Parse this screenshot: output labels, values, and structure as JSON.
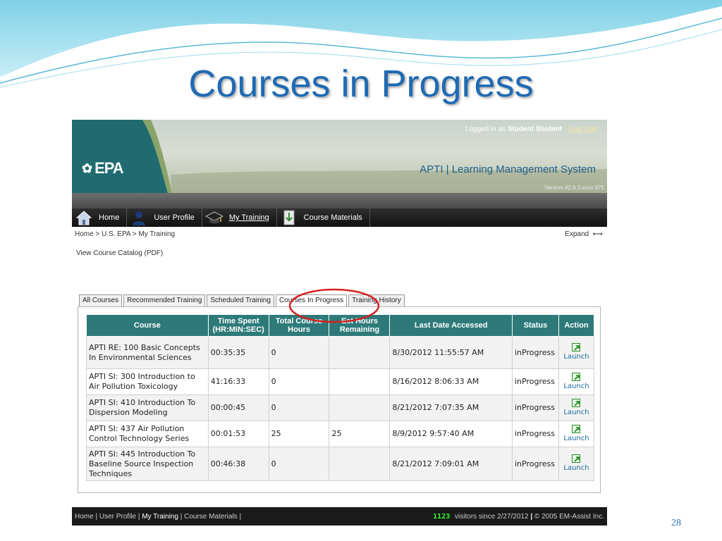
{
  "slide": {
    "title": "Courses in Progress",
    "number": "28"
  },
  "header": {
    "logo_text": "EPA",
    "logged_in_prefix": "Logged in as",
    "user_name": "Student Student",
    "logout_label": "[Log Out]",
    "system_title": "APTI | Learning Management System",
    "version": "Version #2.6.3.xxxx.975"
  },
  "nav": {
    "items": [
      {
        "label": "Home",
        "icon": "house-icon"
      },
      {
        "label": "User Profile",
        "icon": "person-icon"
      },
      {
        "label": "My Training",
        "icon": "graduation-cap-icon"
      },
      {
        "label": "Course Materials",
        "icon": "download-icon"
      }
    ],
    "active": "My Training"
  },
  "breadcrumb": "Home > U.S. EPA > My Training",
  "expand_label": "Expand",
  "catalog_link": "View Course Catalog (PDF)",
  "tabs": [
    {
      "label": "All Courses"
    },
    {
      "label": "Recommended Training"
    },
    {
      "label": "Scheduled Training"
    },
    {
      "label": "Courses In Progress"
    },
    {
      "label": "Training History"
    }
  ],
  "active_tab": "Courses In Progress",
  "table": {
    "headers": {
      "course": "Course",
      "time_spent": "Time Spent (HR:MIN:SEC)",
      "total_hours": "Total Course Hours",
      "est_hours": "Est Hours Remaining",
      "last_accessed": "Last Date Accessed",
      "status": "Status",
      "action": "Action"
    },
    "rows": [
      {
        "course": "APTI RE: 100 Basic Concepts In Environmental Sciences",
        "time_spent": "00:35:35",
        "total_hours": "0",
        "est_hours": "",
        "last_accessed": "8/30/2012 11:55:57 AM",
        "status": "inProgress",
        "action": "Launch"
      },
      {
        "course": "APTI SI: 300 Introduction to Air Pollution Toxicology",
        "time_spent": "41:16:33",
        "total_hours": "0",
        "est_hours": "",
        "last_accessed": "8/16/2012 8:06:33 AM",
        "status": "inProgress",
        "action": "Launch"
      },
      {
        "course": "APTI SI: 410 Introduction To Dispersion Modeling",
        "time_spent": "00:00:45",
        "total_hours": "0",
        "est_hours": "",
        "last_accessed": "8/21/2012 7:07:35 AM",
        "status": "inProgress",
        "action": "Launch"
      },
      {
        "course": "APTI SI: 437 Air Pollution Control Technology Series",
        "time_spent": "00:01:53",
        "total_hours": "25",
        "est_hours": "25",
        "last_accessed": "8/9/2012 9:57:40 AM",
        "status": "inProgress",
        "action": "Launch"
      },
      {
        "course": "APTI SI: 445 Introduction To Baseline Source Inspection Techniques",
        "time_spent": "00:46:38",
        "total_hours": "0",
        "est_hours": "",
        "last_accessed": "8/21/2012 7:09:01 AM",
        "status": "inProgress",
        "action": "Launch"
      }
    ]
  },
  "footer": {
    "links": [
      "Home",
      "User Profile",
      "My Training",
      "Course Materials"
    ],
    "current": "My Training",
    "counter": "1123",
    "visitors_text": "visitors since",
    "since_date": "2/27/2012",
    "copyright": "© 2005 EM-Assist Inc."
  },
  "colors": {
    "title_blue": "#1f6ab3",
    "table_header": "#2e7a7a",
    "highlight_red": "#d42020",
    "counter_green": "#33ff33"
  }
}
